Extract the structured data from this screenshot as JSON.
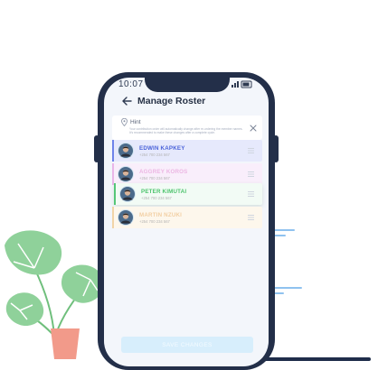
{
  "status_bar": {
    "time": "10:07"
  },
  "header": {
    "title": "Manage Roster"
  },
  "hint": {
    "label": "Hint",
    "text": "Your contribution order will automatically change after re-ordering the member names. It's recommended to make these changes after a complete cycle."
  },
  "roster": [
    {
      "name": "EDWIN KAPKEY",
      "phone": "+254 700 234 567",
      "name_color": "#4a62d9",
      "bg": "#e6e9fc",
      "stripe": "#6e83ea"
    },
    {
      "name": "AGGREY KOROS",
      "phone": "+254 700 234 567",
      "name_color": "#ecb6e3",
      "bg": "#f9eefb",
      "stripe": "#e9b6e8"
    },
    {
      "name": "PETER KIMUTAI",
      "phone": "+254 700 234 567",
      "name_color": "#4cc36c",
      "bg": "#f2fbf5",
      "stripe": "#55c778"
    },
    {
      "name": "MARTIN NZUKI",
      "phone": "+254 700 234 567",
      "name_color": "#f2cfa3",
      "bg": "#fdf7ec",
      "stripe": "#f1d4a8"
    }
  ],
  "footer": {
    "save_label": "SAVE CHANGES"
  },
  "colors": {
    "phone_frame": "#232f49",
    "accent_light": "#d7eefc",
    "plant_leaf": "#8fd19a",
    "pot": "#f29a8a"
  }
}
